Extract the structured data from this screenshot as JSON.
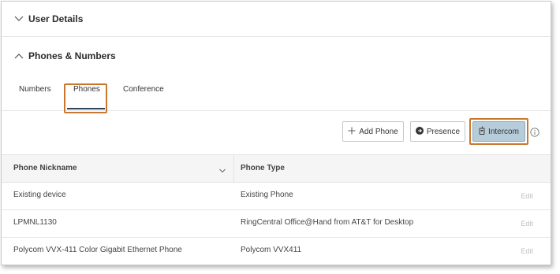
{
  "sections": {
    "user_details": {
      "title": "User Details"
    },
    "phones_numbers": {
      "title": "Phones & Numbers"
    }
  },
  "tabs": [
    {
      "label": "Numbers"
    },
    {
      "label": "Phones",
      "active": true
    },
    {
      "label": "Conference"
    }
  ],
  "toolbar": {
    "add_phone": "Add Phone",
    "presence": "Presence",
    "intercom": "Intercom",
    "info_icon": "info-icon"
  },
  "table": {
    "columns": [
      "Phone Nickname",
      "Phone Type"
    ],
    "rows": [
      {
        "nickname": "Existing device",
        "type": "Existing Phone",
        "action": "Edit"
      },
      {
        "nickname": "LPMNL1130",
        "type": "RingCentral Office@Hand from AT&T for Desktop",
        "action": "Edit"
      },
      {
        "nickname": "Polycom VVX-411 Color Gigabit Ethernet Phone",
        "type": "Polycom VVX411",
        "action": "Edit"
      }
    ]
  },
  "colors": {
    "highlight": "#c8782e",
    "intercom_bg": "#b6ccd9",
    "tab_underline": "#2b4561"
  }
}
